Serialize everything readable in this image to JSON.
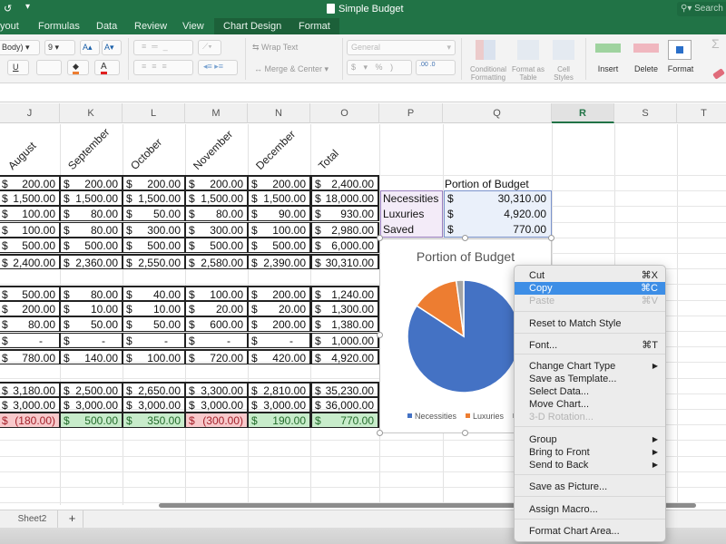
{
  "window": {
    "title": "Simple Budget",
    "search_placeholder": "Search",
    "quick_access": [
      "↺",
      "▾"
    ]
  },
  "ribbon_tabs": [
    {
      "label": "yout"
    },
    {
      "label": "Formulas"
    },
    {
      "label": "Data"
    },
    {
      "label": "Review"
    },
    {
      "label": "View"
    },
    {
      "label": "Chart Design"
    },
    {
      "label": "Format"
    }
  ],
  "ribbon": {
    "font_name": "Body)",
    "font_size": "9",
    "grow_font": "A▴",
    "shrink_font": "A▾",
    "underline": "U",
    "wrap_text": "Wrap Text",
    "merge_center": "Merge & Center",
    "number_format": "General",
    "currency": "$",
    "percent": "%",
    "comma": ")",
    "inc_decimal": ".00",
    "dec_decimal": ".0",
    "conditional_formatting": "Conditional Formatting",
    "format_as_table": "Format as Table",
    "cell_styles": "Cell Styles",
    "insert": "Insert",
    "delete": "Delete",
    "format": "Format",
    "autosum": "Σ"
  },
  "columns": [
    {
      "letter": "J"
    },
    {
      "letter": "K"
    },
    {
      "letter": "L"
    },
    {
      "letter": "M"
    },
    {
      "letter": "N"
    },
    {
      "letter": "O"
    },
    {
      "letter": "P"
    },
    {
      "letter": "Q"
    },
    {
      "letter": "R"
    },
    {
      "letter": "S"
    },
    {
      "letter": "T"
    }
  ],
  "month_headers": [
    "August",
    "September",
    "October",
    "November",
    "December",
    "Total"
  ],
  "necessities_rows": [
    [
      "200.00",
      "200.00",
      "200.00",
      "200.00",
      "200.00",
      "2,400.00"
    ],
    [
      "1,500.00",
      "1,500.00",
      "1,500.00",
      "1,500.00",
      "1,500.00",
      "18,000.00"
    ],
    [
      "100.00",
      "80.00",
      "50.00",
      "80.00",
      "90.00",
      "930.00"
    ],
    [
      "100.00",
      "80.00",
      "300.00",
      "300.00",
      "100.00",
      "2,980.00"
    ],
    [
      "500.00",
      "500.00",
      "500.00",
      "500.00",
      "500.00",
      "6,000.00"
    ]
  ],
  "necessities_total": [
    "2,400.00",
    "2,360.00",
    "2,550.00",
    "2,580.00",
    "2,390.00",
    "30,310.00"
  ],
  "luxuries_rows": [
    [
      "500.00",
      "80.00",
      "40.00",
      "100.00",
      "200.00",
      "1,240.00"
    ],
    [
      "200.00",
      "10.00",
      "10.00",
      "20.00",
      "20.00",
      "1,300.00"
    ],
    [
      "80.00",
      "50.00",
      "50.00",
      "600.00",
      "200.00",
      "1,380.00"
    ],
    [
      "-",
      "-",
      "-",
      "-",
      "-",
      "1,000.00"
    ]
  ],
  "luxuries_total": [
    "780.00",
    "140.00",
    "100.00",
    "720.00",
    "420.00",
    "4,920.00"
  ],
  "summary_rows": [
    [
      "3,180.00",
      "2,500.00",
      "2,650.00",
      "3,300.00",
      "2,810.00",
      "35,230.00"
    ],
    [
      "3,000.00",
      "3,000.00",
      "3,000.00",
      "3,000.00",
      "3,000.00",
      "36,000.00"
    ]
  ],
  "saved_row": [
    {
      "value": "(180.00)",
      "status": "neg"
    },
    {
      "value": "500.00",
      "status": "pos"
    },
    {
      "value": "350.00",
      "status": "pos"
    },
    {
      "value": "(300.00)",
      "status": "neg"
    },
    {
      "value": "190.00",
      "status": "pos"
    },
    {
      "value": "770.00",
      "status": "pos"
    }
  ],
  "currency_symbol": "$",
  "portion_table": {
    "title": "Portion of Budget",
    "rows": [
      {
        "label": "Necessities",
        "value": "30,310.00"
      },
      {
        "label": "Luxuries",
        "value": "4,920.00"
      },
      {
        "label": "Saved",
        "value": "770.00"
      }
    ]
  },
  "chart_data": {
    "type": "pie",
    "title": "Portion of Budget",
    "categories": [
      "Necessities",
      "Luxuries",
      "Saved"
    ],
    "values": [
      30310,
      4920,
      770
    ],
    "colors": [
      "#4472c4",
      "#ed7d31",
      "#a5a5a5"
    ],
    "legend": "bottom",
    "legend_labels": [
      "Necessities",
      "Luxuries",
      "S"
    ]
  },
  "context_menu": {
    "items": [
      {
        "label": "Cut",
        "shortcut": "⌘X",
        "state": "normal"
      },
      {
        "label": "Copy",
        "shortcut": "⌘C",
        "state": "highlighted"
      },
      {
        "label": "Paste",
        "shortcut": "⌘V",
        "state": "disabled"
      },
      {
        "label": "Reset to Match Style",
        "shortcut": "",
        "state": "normal"
      },
      {
        "label": "Font...",
        "shortcut": "⌘T",
        "state": "normal"
      },
      {
        "label": "Change Chart Type",
        "shortcut": "▶",
        "state": "normal"
      },
      {
        "label": "Save as Template...",
        "shortcut": "",
        "state": "normal"
      },
      {
        "label": "Select Data...",
        "shortcut": "",
        "state": "normal"
      },
      {
        "label": "Move Chart...",
        "shortcut": "",
        "state": "normal"
      },
      {
        "label": "3-D Rotation...",
        "shortcut": "",
        "state": "disabled"
      },
      {
        "label": "Group",
        "shortcut": "▶",
        "state": "normal"
      },
      {
        "label": "Bring to Front",
        "shortcut": "▶",
        "state": "normal"
      },
      {
        "label": "Send to Back",
        "shortcut": "▶",
        "state": "normal"
      },
      {
        "label": "Save as Picture...",
        "shortcut": "",
        "state": "normal"
      },
      {
        "label": "Assign Macro...",
        "shortcut": "",
        "state": "normal"
      },
      {
        "label": "Format Chart Area...",
        "shortcut": "",
        "state": "normal"
      }
    ]
  },
  "sheets": {
    "tabs": [
      {
        "label": "Sheet2"
      }
    ],
    "add_label": "+"
  },
  "colors": {
    "excel_green": "#217346",
    "menu_highlight": "#3d8ee6",
    "negative_fill": "#f8c9cb",
    "positive_fill": "#c8eccb"
  }
}
